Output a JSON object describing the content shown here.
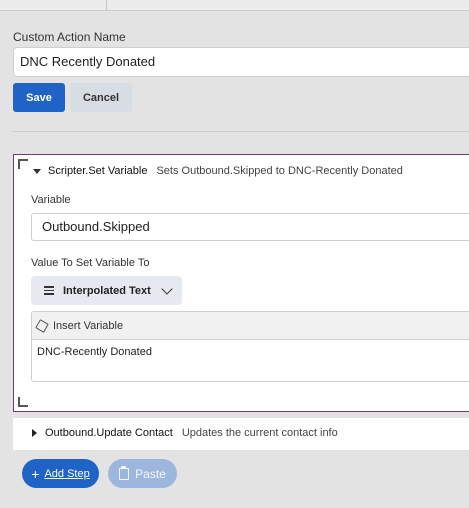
{
  "form": {
    "name_label": "Custom Action Name",
    "name_value": "DNC Recently Donated",
    "save_label": "Save",
    "cancel_label": "Cancel"
  },
  "steps": [
    {
      "name": "Scripter.Set Variable",
      "description": "Sets Outbound.Skipped to DNC-Recently Donated",
      "expanded": true,
      "variable_label": "Variable",
      "variable_value": "Outbound.Skipped",
      "value_label": "Value To Set Variable To",
      "value_mode": "Interpolated Text",
      "insert_variable_label": "Insert Variable",
      "value_text": "DNC-Recently Donated"
    },
    {
      "name": "Outbound.Update Contact",
      "description": "Updates the current contact info",
      "expanded": false
    }
  ],
  "actions": {
    "add_step_label": "Add Step",
    "paste_label": "Paste"
  },
  "colors": {
    "primary": "#1f63c6",
    "selected_border": "#6b3c6e",
    "disabled_button": "#9db6dd"
  }
}
